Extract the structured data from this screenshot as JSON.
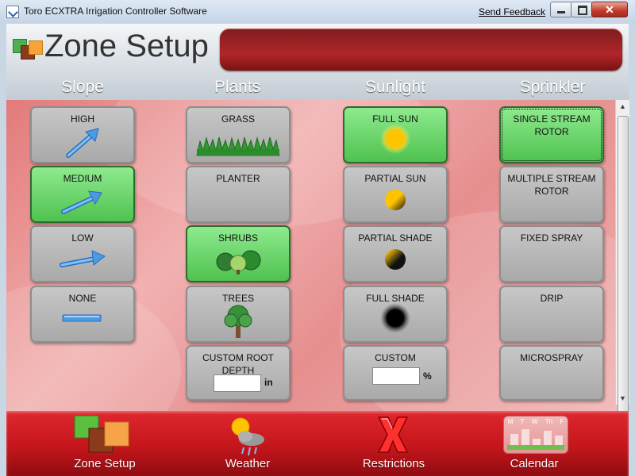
{
  "window": {
    "title": "Toro ECXTRA Irrigation Controller Software",
    "send_feedback": "Send Feedback",
    "close_glyph": "✕"
  },
  "header": {
    "page_title": "Zone Setup",
    "columns": [
      "Slope",
      "Plants",
      "Sunlight",
      "Sprinkler"
    ]
  },
  "slope": [
    {
      "label": "HIGH",
      "icon": "arrow-high-icon",
      "selected": false
    },
    {
      "label": "MEDIUM",
      "icon": "arrow-medium-icon",
      "selected": true
    },
    {
      "label": "LOW",
      "icon": "arrow-low-icon",
      "selected": false
    },
    {
      "label": "NONE",
      "icon": "flat-bar-icon",
      "selected": false
    }
  ],
  "plants": [
    {
      "label": "GRASS",
      "icon": "grass-icon",
      "selected": false
    },
    {
      "label": "PLANTER",
      "icon": "",
      "selected": false
    },
    {
      "label": "SHRUBS",
      "icon": "shrubs-icon",
      "selected": true
    },
    {
      "label": "TREES",
      "icon": "tree-icon",
      "selected": false
    },
    {
      "label": "CUSTOM ROOT DEPTH",
      "unit": "in",
      "value": "",
      "selected": false
    }
  ],
  "sunlight": [
    {
      "label": "FULL SUN",
      "icon": "full-sun-icon",
      "selected": true
    },
    {
      "label": "PARTIAL SUN",
      "icon": "partial-sun-icon",
      "selected": false
    },
    {
      "label": "PARTIAL SHADE",
      "icon": "partial-shade-icon",
      "selected": false
    },
    {
      "label": "FULL SHADE",
      "icon": "full-shade-icon",
      "selected": false
    },
    {
      "label": "CUSTOM",
      "unit": "%",
      "value": "",
      "selected": false
    }
  ],
  "sprinkler": [
    {
      "label": "SINGLE STREAM ROTOR",
      "selected": true
    },
    {
      "label": "MULTIPLE STREAM ROTOR",
      "selected": false
    },
    {
      "label": "FIXED SPRAY",
      "selected": false
    },
    {
      "label": "DRIP",
      "selected": false
    },
    {
      "label": "MICROSPRAY",
      "selected": false
    }
  ],
  "nav": [
    {
      "label": "Zone Setup",
      "icon": "zone-setup-icon"
    },
    {
      "label": "Weather",
      "icon": "weather-icon"
    },
    {
      "label": "Restrictions",
      "icon": "restrictions-icon"
    },
    {
      "label": "Calendar",
      "icon": "calendar-icon"
    }
  ],
  "calendar_icon_days": [
    "M",
    "T",
    "W",
    "Th",
    "F"
  ],
  "colors": {
    "selected_green": "#4fc24f",
    "header_banner_red": "#b0262a",
    "nav_red": "#d21f25"
  }
}
